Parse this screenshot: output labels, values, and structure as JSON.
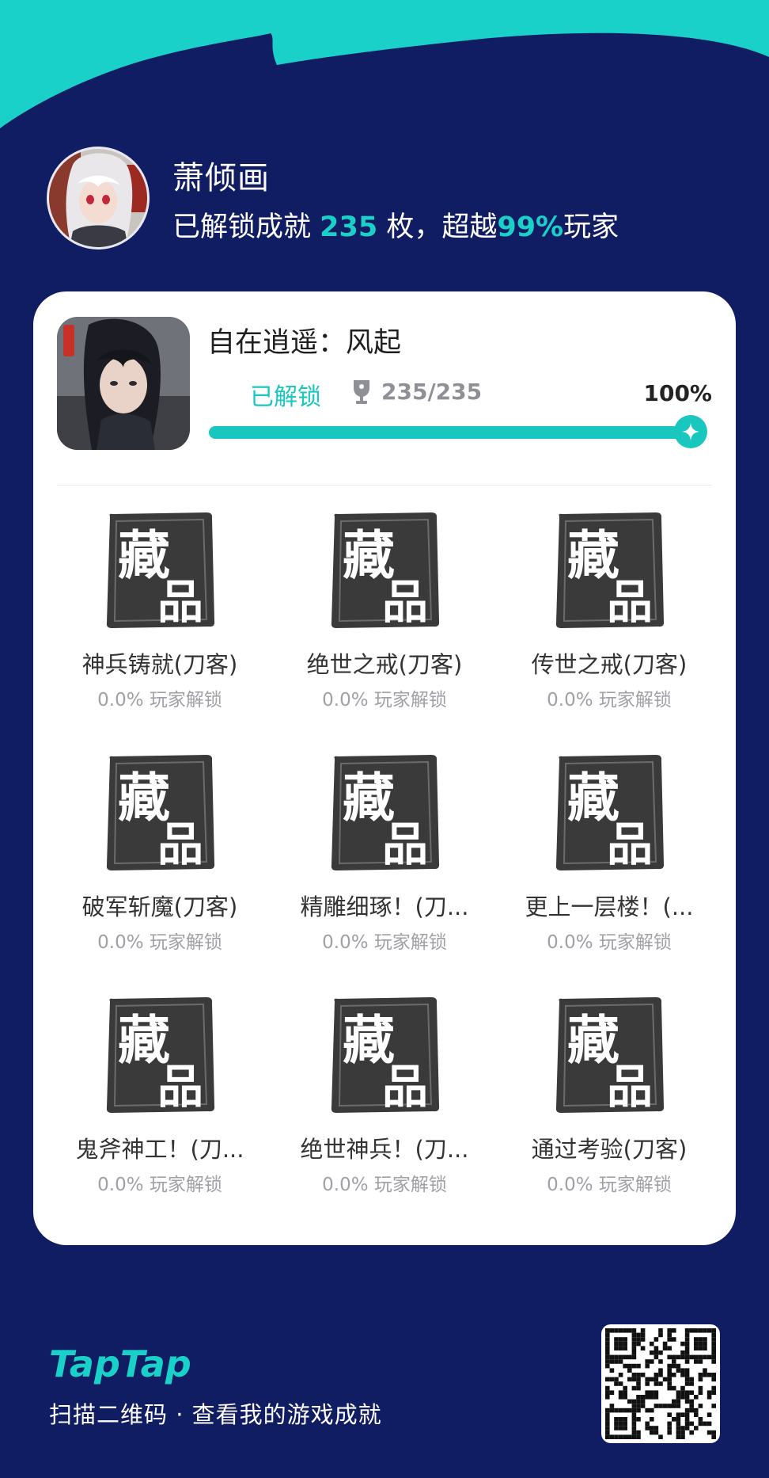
{
  "user": {
    "name": "萧倾画",
    "stat_prefix": "已解锁成就 ",
    "unlocked_count": "235",
    "stat_middle": " 枚，超越",
    "beat_percent": "99%",
    "stat_suffix": "玩家"
  },
  "game": {
    "title": "自在逍遥：风起",
    "status": "已解锁",
    "progress_text": "235/235",
    "percent_text": "100%",
    "progress": 1.0
  },
  "achievements": [
    {
      "name": "神兵铸就(刀客)",
      "rate": "0.0% 玩家解锁",
      "badge_text": "藏品"
    },
    {
      "name": "绝世之戒(刀客)",
      "rate": "0.0% 玩家解锁",
      "badge_text": "藏品"
    },
    {
      "name": "传世之戒(刀客)",
      "rate": "0.0% 玩家解锁",
      "badge_text": "藏品"
    },
    {
      "name": "破军斩魔(刀客)",
      "rate": "0.0% 玩家解锁",
      "badge_text": "藏品"
    },
    {
      "name": "精雕细琢！(刀...",
      "rate": "0.0% 玩家解锁",
      "badge_text": "藏品"
    },
    {
      "name": "更上一层楼！(...",
      "rate": "0.0% 玩家解锁",
      "badge_text": "藏品"
    },
    {
      "name": "鬼斧神工！(刀...",
      "rate": "0.0% 玩家解锁",
      "badge_text": "藏品"
    },
    {
      "name": "绝世神兵！(刀...",
      "rate": "0.0% 玩家解锁",
      "badge_text": "藏品"
    },
    {
      "name": "通过考验(刀客)",
      "rate": "0.0% 玩家解锁",
      "badge_text": "藏品"
    }
  ],
  "footer": {
    "brand": "TapTap",
    "scan_text": "扫描二维码 · 查看我的游戏成就"
  },
  "colors": {
    "accent": "#19c7bf",
    "background": "#111d63",
    "wave": "#19d1c8"
  },
  "icons": {
    "trophy": "trophy-icon",
    "knob": "sparkle-icon",
    "badge": "collection-seal-icon"
  }
}
